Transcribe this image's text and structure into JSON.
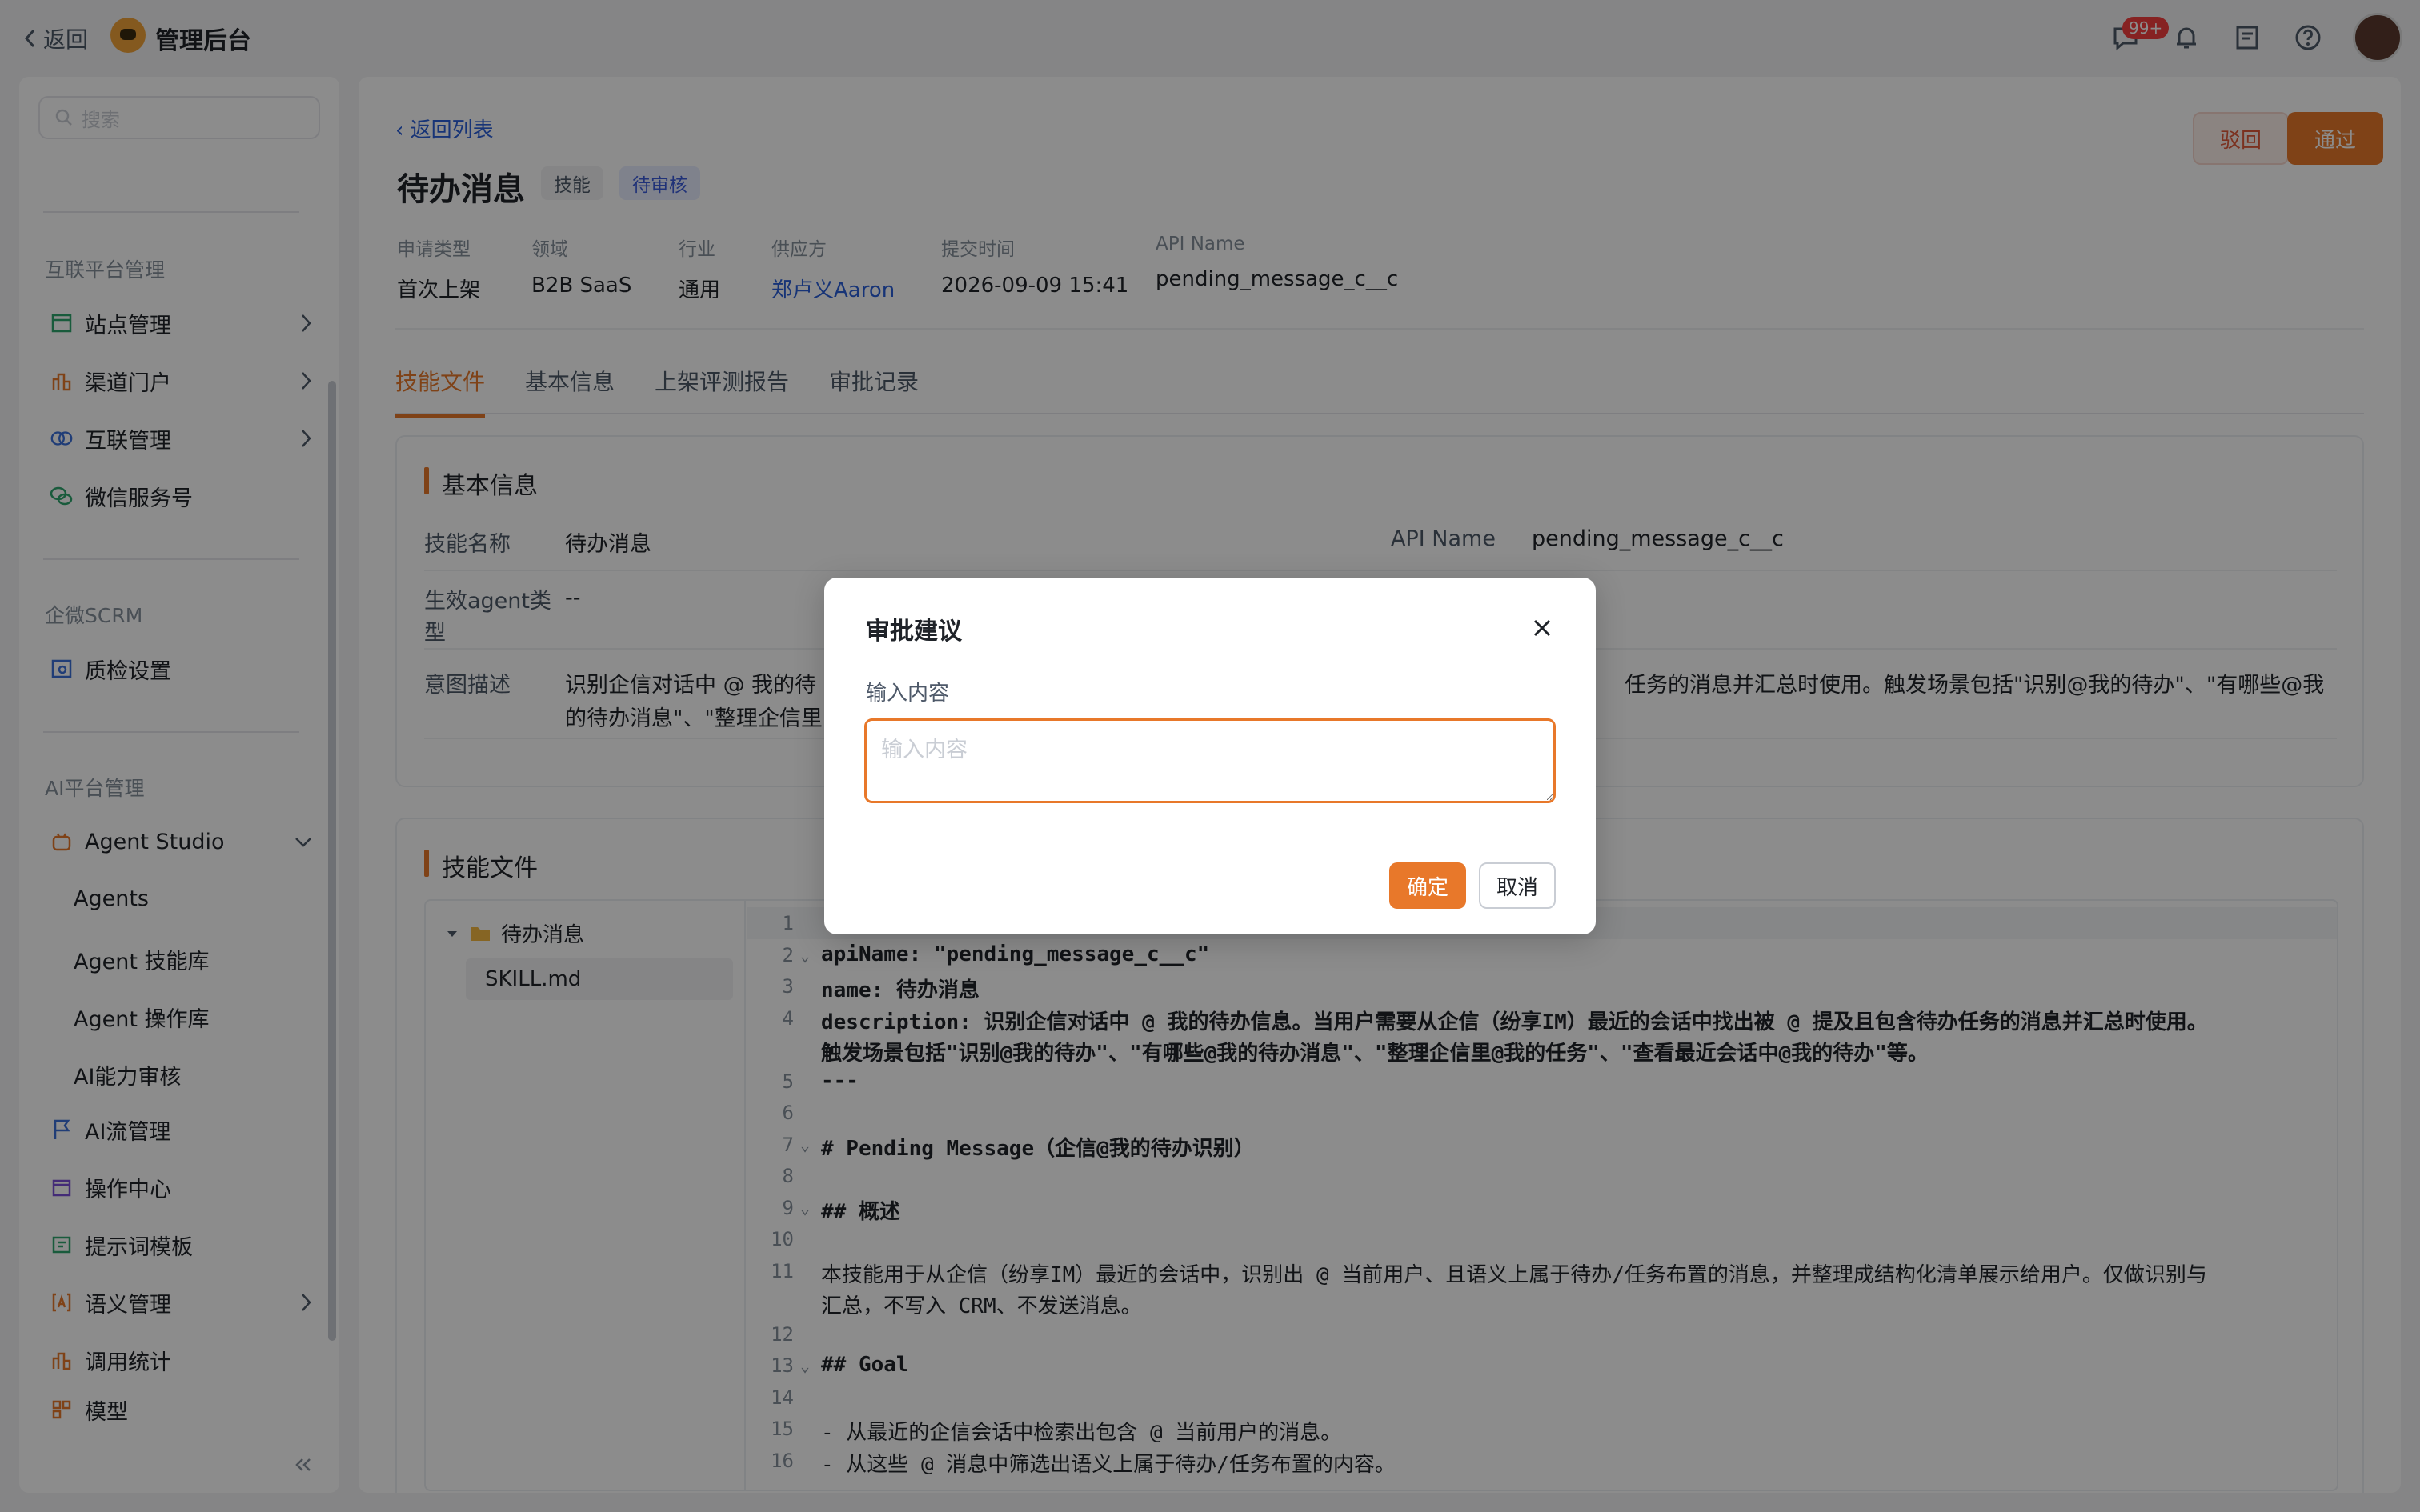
{
  "topbar": {
    "back_label": "返回",
    "app_title": "管理后台",
    "message_badge": "99+"
  },
  "sidebar": {
    "search_placeholder": "搜索",
    "groups": [
      {
        "title": "互联平台管理",
        "items": [
          "站点管理",
          "渠道门户",
          "互联管理",
          "微信服务号"
        ]
      },
      {
        "title": "企微SCRM",
        "items": [
          "质检设置"
        ]
      },
      {
        "title": "AI平台管理",
        "items": [
          "Agent Studio"
        ],
        "sub_items": [
          "Agents",
          "Agent 技能库",
          "Agent 操作库",
          "AI能力审核"
        ],
        "more_items": [
          "AI流管理",
          "操作中心",
          "提示词模板",
          "语义管理",
          "调用统计",
          "模型"
        ]
      }
    ]
  },
  "page": {
    "back_list": "返回列表",
    "title": "待办消息",
    "tag_type": "技能",
    "tag_status": "待审核",
    "reject_label": "驳回",
    "pass_label": "通过",
    "meta": [
      {
        "label": "申请类型",
        "value": "首次上架"
      },
      {
        "label": "领域",
        "value": "B2B SaaS"
      },
      {
        "label": "行业",
        "value": "通用"
      },
      {
        "label": "供应方",
        "value": "郑卢义Aaron"
      },
      {
        "label": "提交时间",
        "value": "2026-09-09 15:41"
      },
      {
        "label": "API Name",
        "value": "pending_message_c__c"
      }
    ],
    "tabs": [
      "技能文件",
      "基本信息",
      "上架评测报告",
      "审批记录"
    ],
    "basic": {
      "title": "基本信息",
      "skill_name_label": "技能名称",
      "skill_name": "待办消息",
      "api_name_label": "API Name",
      "api_name": "pending_message_c__c",
      "agent_type_label": "生效agent类型",
      "agent_type": "--",
      "intent_label": "意图描述",
      "intent_left": "识别企信对话中 @ 我的待",
      "intent_left2": "的待办消息\"、\"整理企信里",
      "intent_right": "任务的消息并汇总时使用。触发场景包括\"识别@我的待办\"、\"有哪些@我"
    },
    "files": {
      "title": "技能文件",
      "folder": "待办消息",
      "file": "SKILL.md",
      "lines": [
        {
          "n": "1",
          "t": "---",
          "b": false,
          "fold": false
        },
        {
          "n": "2",
          "t": "apiName: \"pending_message_c__c\"",
          "b": true,
          "fold": true
        },
        {
          "n": "3",
          "t": "name: 待办消息",
          "b": true,
          "fold": false
        },
        {
          "n": "4",
          "t": "description: 识别企信对话中 @ 我的待办信息。当用户需要从企信（纷享IM）最近的会话中找出被 @ 提及且包含待办任务的消息并汇总时使用。",
          "b": true,
          "fold": false
        },
        {
          "n": "",
          "t": "触发场景包括\"识别@我的待办\"、\"有哪些@我的待办消息\"、\"整理企信里@我的任务\"、\"查看最近会话中@我的待办\"等。",
          "b": true,
          "fold": false
        },
        {
          "n": "5",
          "t": "---",
          "b": true,
          "fold": false
        },
        {
          "n": "6",
          "t": "",
          "b": false,
          "fold": false
        },
        {
          "n": "7",
          "t": "# Pending Message（企信@我的待办识别）",
          "b": true,
          "fold": true
        },
        {
          "n": "8",
          "t": "",
          "b": false,
          "fold": false
        },
        {
          "n": "9",
          "t": "## 概述",
          "b": true,
          "fold": true
        },
        {
          "n": "10",
          "t": "",
          "b": false,
          "fold": false
        },
        {
          "n": "11",
          "t": "本技能用于从企信（纷享IM）最近的会话中，识别出 @ 当前用户、且语义上属于待办/任务布置的消息，并整理成结构化清单展示给用户。仅做识别与",
          "b": false,
          "fold": false
        },
        {
          "n": "",
          "t": "汇总，不写入 CRM、不发送消息。",
          "b": false,
          "fold": false
        },
        {
          "n": "12",
          "t": "",
          "b": false,
          "fold": false
        },
        {
          "n": "13",
          "t": "## Goal",
          "b": true,
          "fold": true
        },
        {
          "n": "14",
          "t": "",
          "b": false,
          "fold": false
        },
        {
          "n": "15",
          "t": "- 从最近的企信会话中检索出包含 @ 当前用户的消息。",
          "b": false,
          "fold": false
        },
        {
          "n": "16",
          "t": "- 从这些 @ 消息中筛选出语义上属于待办/任务布置的内容。",
          "b": false,
          "fold": false
        }
      ]
    }
  },
  "modal": {
    "title": "审批建议",
    "label": "输入内容",
    "placeholder": "输入内容",
    "value": "",
    "ok_label": "确定",
    "cancel_label": "取消"
  }
}
